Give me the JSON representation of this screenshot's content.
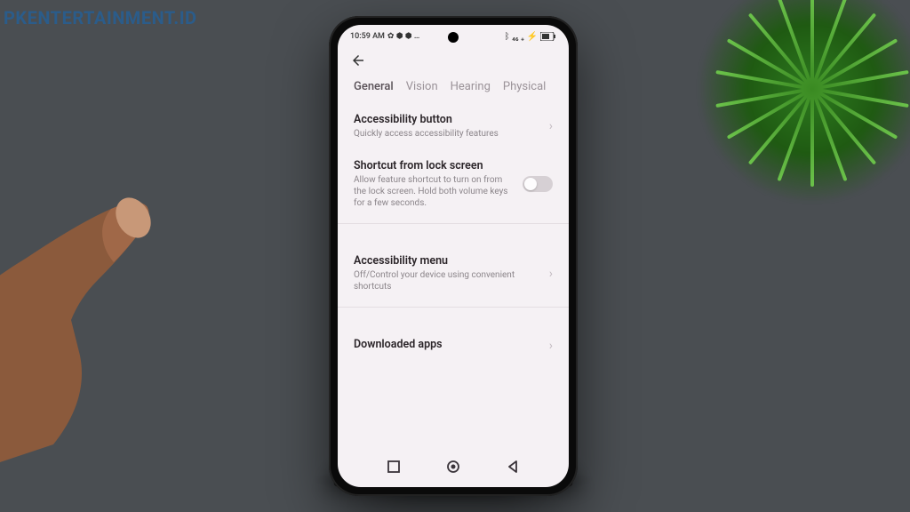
{
  "watermark": "PKENTERTAINMENT.ID",
  "status": {
    "time": "10:59 AM",
    "left_icons": "✿ ⬢ ⬢ …",
    "right_icons": "ᛒ ₄₆ ₊ ⚡"
  },
  "tabs": {
    "items": [
      "General",
      "Vision",
      "Hearing",
      "Physical"
    ],
    "active": 0
  },
  "settings": {
    "accessibility_button": {
      "title": "Accessibility button",
      "sub": "Quickly access accessibility features"
    },
    "shortcut_lock": {
      "title": "Shortcut from lock screen",
      "sub": "Allow feature shortcut to turn on from the lock screen. Hold both volume keys for a few seconds."
    },
    "accessibility_menu": {
      "title": "Accessibility menu",
      "sub": "Off/Control your device using convenient shortcuts"
    },
    "downloaded_apps": {
      "title": "Downloaded apps"
    }
  }
}
